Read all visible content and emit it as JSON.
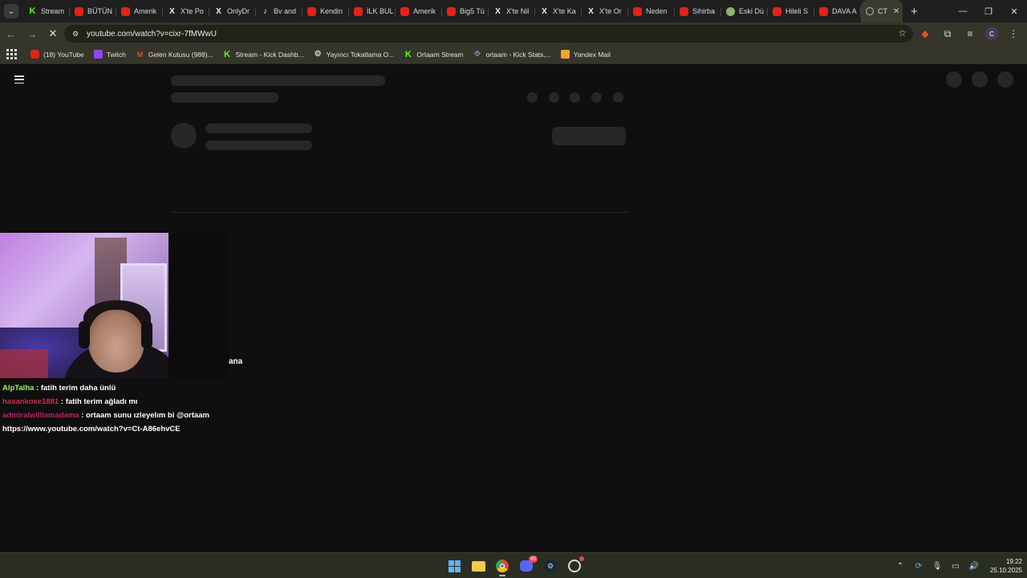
{
  "tabs": [
    {
      "label": "Stream",
      "icon": "kick-icon"
    },
    {
      "label": "BÜTÜN",
      "icon": "youtube-icon"
    },
    {
      "label": "Amerik",
      "icon": "youtube-icon"
    },
    {
      "label": "X'te Po",
      "icon": "x-icon"
    },
    {
      "label": "OnlyDr",
      "icon": "x-icon"
    },
    {
      "label": "Bv and",
      "icon": "tiktok-icon"
    },
    {
      "label": "Kendin",
      "icon": "youtube-icon"
    },
    {
      "label": "İLK BUL",
      "icon": "youtube-icon"
    },
    {
      "label": "Amerik",
      "icon": "youtube-icon"
    },
    {
      "label": "Big5 Tü",
      "icon": "youtube-icon"
    },
    {
      "label": "X'te Nil",
      "icon": "x-icon"
    },
    {
      "label": "X'te Ka",
      "icon": "x-icon"
    },
    {
      "label": "X'te Or",
      "icon": "x-icon"
    },
    {
      "label": "Neden",
      "icon": "youtube-icon"
    },
    {
      "label": "Sihirba",
      "icon": "youtube-icon"
    },
    {
      "label": "Eski Dü",
      "icon": "wiki-icon"
    },
    {
      "label": "Hileli S",
      "icon": "youtube-icon"
    },
    {
      "label": "DAVA A",
      "icon": "youtube-icon"
    },
    {
      "label": "CT",
      "icon": "loading-icon",
      "active": true
    }
  ],
  "address_bar": {
    "url": "youtube.com/watch?v=cixr-7fMWwU"
  },
  "bookmarks": [
    {
      "label": "(18) YouTube",
      "icon": "youtube-icon"
    },
    {
      "label": "Twitch",
      "icon": "twitch-icon"
    },
    {
      "label": "Gelen Kutusu (988)...",
      "icon": "gmail-icon"
    },
    {
      "label": "Stream - Kick Dashb...",
      "icon": "kick-icon"
    },
    {
      "label": "Yayıncı Tokatlama O...",
      "icon": "globe-icon"
    },
    {
      "label": "Ortaam Stream",
      "icon": "kick-icon"
    },
    {
      "label": "ortaam - Kick Stats,...",
      "icon": "stats-icon"
    },
    {
      "label": "Yandex Mail",
      "icon": "mail-icon"
    }
  ],
  "overlay": {
    "stray_text": "ana"
  },
  "chat": [
    {
      "user": "AlpTalha",
      "message": " : fatih terim daha ünlü",
      "color": "#9cf36a"
    },
    {
      "user": "hasankose1881",
      "message": " : fatih terim ağladı mı",
      "color": "#ca2d4a"
    },
    {
      "user": "admiralwilliamadama",
      "message": " : ortaam sunu ızleyelım bi @ortaam",
      "color": "#b8236b"
    },
    {
      "user": "",
      "message": "https://www.youtube.com/watch?v=Ct-A86ehvCE",
      "color": "#ffffff"
    }
  ],
  "taskbar": {
    "discord_badge": "99",
    "time": "19:22",
    "date": "25.10.2025"
  },
  "colors": {
    "accent": "#35352a",
    "page_bg": "#0f0f0f",
    "skeleton": "#272727"
  }
}
